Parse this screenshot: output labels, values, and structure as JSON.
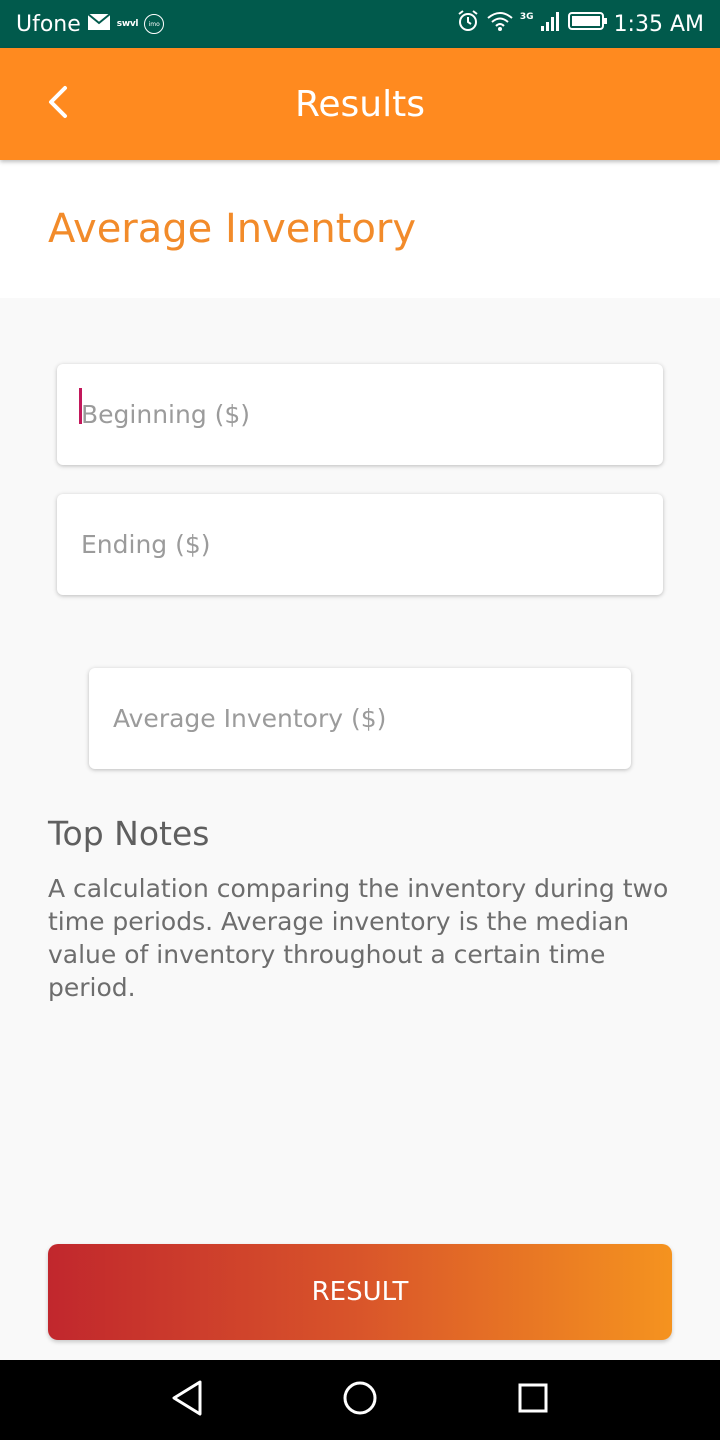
{
  "status_bar": {
    "carrier": "Ufone",
    "notification_text": "swvl",
    "imo_label": "imo",
    "network_type": "3G",
    "time": "1:35 AM"
  },
  "app_bar": {
    "title": "Results",
    "back_icon": "chevron-left-icon"
  },
  "section": {
    "title": "Average Inventory"
  },
  "inputs": {
    "beginning": {
      "placeholder": "Beginning ($)",
      "value": ""
    },
    "ending": {
      "placeholder": "Ending ($)",
      "value": ""
    },
    "average": {
      "placeholder": "Average Inventory ($)",
      "value": ""
    }
  },
  "notes": {
    "title": "Top Notes",
    "body": "A calculation comparing the inventory during two time periods. Average inventory is the median value of inventory throughout a certain time period."
  },
  "result_button": {
    "label": "RESULT"
  },
  "nav_bar": {
    "icons": [
      "back-triangle-icon",
      "home-circle-icon",
      "recents-square-icon"
    ]
  },
  "colors": {
    "status_bar": "#015a4c",
    "app_bar": "#ff8a1f",
    "accent": "#f28b2a",
    "button_start": "#c1272d",
    "button_end": "#f5931f"
  }
}
